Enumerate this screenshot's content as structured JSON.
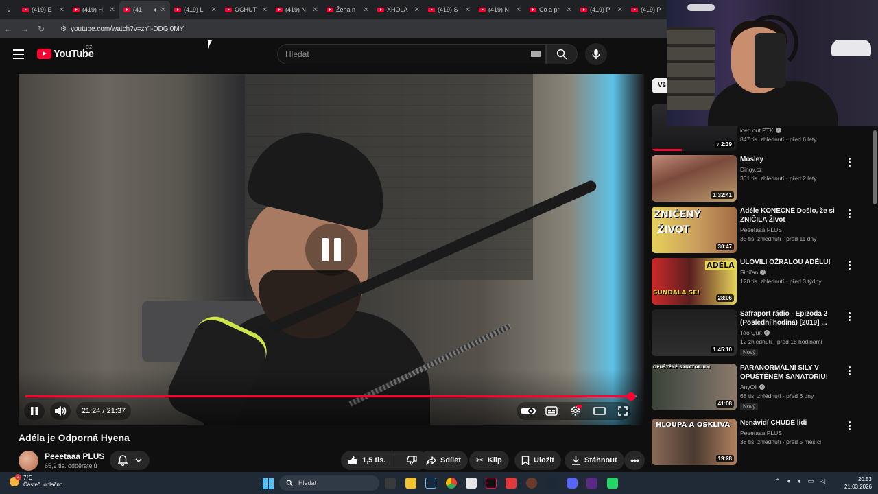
{
  "browser": {
    "tabs": [
      {
        "label": "(419) E"
      },
      {
        "label": "(419) H"
      },
      {
        "label": "(41"
      },
      {
        "label": "(419) L"
      },
      {
        "label": "OCHUT"
      },
      {
        "label": "(419) N"
      },
      {
        "label": "Žena n"
      },
      {
        "label": "XHOLA"
      },
      {
        "label": "(419) S"
      },
      {
        "label": "(419) N"
      },
      {
        "label": "Co a pr"
      },
      {
        "label": "(419) P"
      },
      {
        "label": "(419) P"
      }
    ],
    "url": "youtube.com/watch?v=zYI-DDGi0MY"
  },
  "header": {
    "logo_text": "YouTube",
    "country": "CZ",
    "search_placeholder": "Hledat"
  },
  "player": {
    "current_time": "21:24",
    "duration": "21:37",
    "time_display": "21:24 / 21:37",
    "progress_fraction": 0.99
  },
  "video": {
    "title": "Adéla je Odporná Hyena",
    "channel": "Peeetaaa PLUS",
    "subscribers": "65,9 tis. odběratelů",
    "likes": "1,5 tis.",
    "actions": {
      "share": "Sdílet",
      "clip": "Klip",
      "save": "Uložit",
      "download": "Stáhnout"
    }
  },
  "sidebar": {
    "chip": "Vš",
    "recommendations": [
      {
        "title": "",
        "channel": "iced out PTK",
        "verified": true,
        "meta": "847 tis. zhlédnutí · před 6 lety",
        "duration": "2:39",
        "music": true,
        "new": false,
        "watched": true
      },
      {
        "title": "Mosley",
        "channel": "Dingy.cz",
        "verified": false,
        "meta": "331 tis. zhlédnutí · před 2 lety",
        "duration": "1:32:41",
        "new": false
      },
      {
        "title": "Adéle KONEČNĚ Došlo, že si ZNIČILA Život",
        "channel": "Peeetaaa PLUS",
        "verified": false,
        "meta": "35 tis. zhlédnutí · před 11 dny",
        "duration": "30:47",
        "new": false,
        "thumb_text": [
          "ZNIČENÝ",
          "ŽIVOT"
        ]
      },
      {
        "title": "ULOVILI OŽRALOU ADÉLU!",
        "channel": "Sibiřan",
        "verified": true,
        "meta": "120 tis. zhlédnutí · před 3 týdny",
        "duration": "28:06",
        "new": false,
        "thumb_text": [
          "ADÉLA",
          "SUNDALA SE!"
        ]
      },
      {
        "title": "Safraport rádio - Epizoda 2 (Poslední hodina) [2019] ...",
        "channel": "Tao Quit",
        "verified": true,
        "meta": "12 zhlédnutí · před 18 hodinami",
        "duration": "1:45:10",
        "new": true
      },
      {
        "title": "PARANORMÁLNÍ SÍLY V OPUŠTĚNÉM SANATORIU!",
        "channel": "AnyOli",
        "verified": true,
        "meta": "68 tis. zhlédnutí · před 6 dny",
        "duration": "41:08",
        "new": true,
        "thumb_text": [
          "OPUŠTĚNÉ SANATORIUM"
        ]
      },
      {
        "title": "Nenávidí CHUDÉ lidi",
        "channel": "Peeetaaa PLUS",
        "verified": false,
        "meta": "38 tis. zhlédnutí · před 5 měsíci",
        "duration": "19:28",
        "new": false,
        "thumb_text": [
          "HLOUPÁ A OŠKLIVÁ"
        ]
      }
    ],
    "new_label": "Nový"
  },
  "taskbar": {
    "weather_temp": "7°C",
    "weather_desc": "Částeč. oblačno",
    "notification_count": "2",
    "search_placeholder": "Hledat",
    "time": "20:53",
    "date": "21.03.2026"
  }
}
